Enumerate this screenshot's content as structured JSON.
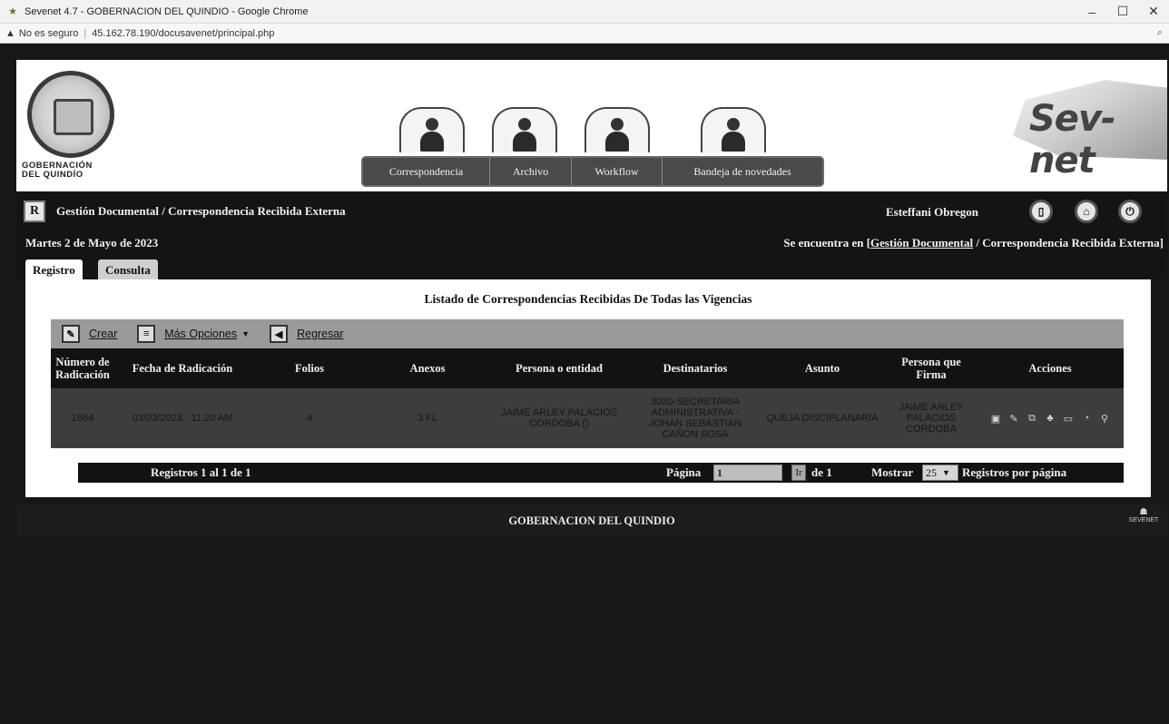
{
  "browser": {
    "window_title": "Sevenet 4.7 - GOBERNACION DEL QUINDIO - Google Chrome",
    "security": "No es seguro",
    "url": "45.162.78.190/docusavenet/principal.php"
  },
  "header": {
    "logo_text_line1": "GOBERNACIÓN",
    "logo_text_line2": "DEL QUINDÍO",
    "brand_text": "Sev-net",
    "nav": [
      {
        "label": "Correspondencia",
        "icon": "user-mail-icon"
      },
      {
        "label": "Archivo",
        "icon": "user-archive-icon"
      },
      {
        "label": "Workflow",
        "icon": "user-clock-icon"
      },
      {
        "label": "Bandeja de novedades",
        "icon": "user-inbox-icon"
      }
    ]
  },
  "module": {
    "title": "Gestión Documental / Correspondencia Recibida Externa",
    "user": "Esteffani Obregon"
  },
  "info": {
    "date": "Martes 2 de Mayo de 2023",
    "location_prefix": "Se encuentra en [",
    "location_link": "Gestión Documental",
    "location_suffix": " / Correspondencia Recibida Externa]"
  },
  "tabs": [
    "Registro",
    "Consulta"
  ],
  "list": {
    "title": "Listado de Correspondencias Recibidas De Todas las Vigencias",
    "toolbar": {
      "crear": "Crear",
      "mas_opciones": "Más Opciones",
      "regresar": "Regresar"
    },
    "columns": [
      "Número de Radicación",
      "Fecha de Radicación",
      "Folios",
      "Anexos",
      "Persona o entidad",
      "Destinatarios",
      "Asunto",
      "Persona que Firma",
      "Acciones"
    ],
    "rows": [
      {
        "numero": "1664",
        "fecha": "03/03/2023 - 11:20 AM",
        "folios": "4",
        "anexos": "3 FL",
        "persona": "JAIME ARLEY PALACIOS CORDOBA ()",
        "destinatarios": "3030-SECRETARIA ADMINISTRATIVA - JOHAN SEBASTIAN CAÑON SOSA",
        "asunto": "QUEJA DISCIPLANARIA",
        "firma": "JAIME ARLEY PALACIOS CORDOBA"
      }
    ]
  },
  "pager": {
    "registros": "Registros 1 al 1 de 1",
    "pagina_label": "Página",
    "pagina_value": "1",
    "ir": "Ir",
    "de": "de 1",
    "mostrar": "Mostrar",
    "page_size": "25",
    "por_pagina": "Registros por página"
  },
  "footer": {
    "text": "GOBERNACION DEL QUINDIO",
    "logo_text": "SEVENET"
  }
}
